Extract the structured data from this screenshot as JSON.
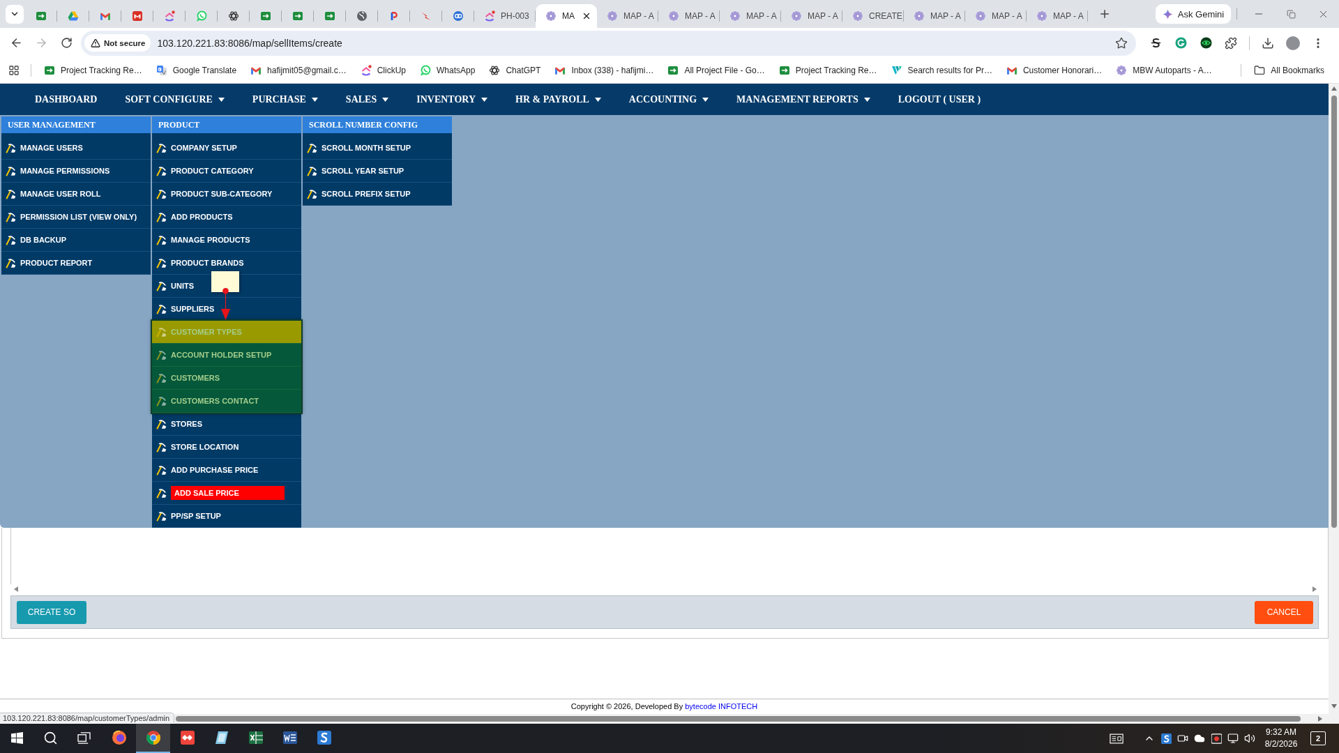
{
  "browser": {
    "tabs": [
      {
        "kind": "icon",
        "selected": false
      },
      {
        "kind": "icon",
        "selected": false
      },
      {
        "kind": "icon",
        "selected": false
      },
      {
        "kind": "icon",
        "selected": false
      },
      {
        "kind": "icon",
        "selected": false
      },
      {
        "kind": "icon",
        "selected": false
      },
      {
        "kind": "icon",
        "selected": false
      },
      {
        "kind": "icon",
        "selected": false
      },
      {
        "kind": "icon",
        "selected": false
      },
      {
        "kind": "icon",
        "selected": false
      },
      {
        "kind": "icon",
        "selected": false
      },
      {
        "kind": "icon",
        "selected": false
      },
      {
        "kind": "icon",
        "selected": false
      },
      {
        "kind": "icon",
        "selected": false
      },
      {
        "kind": "titled",
        "title": "PH-003",
        "selected": false
      },
      {
        "kind": "titled",
        "title": "MA",
        "selected": true
      },
      {
        "kind": "titled",
        "title": "MAP - A",
        "selected": false
      },
      {
        "kind": "titled",
        "title": "MAP - A",
        "selected": false
      },
      {
        "kind": "titled",
        "title": "MAP - A",
        "selected": false
      },
      {
        "kind": "titled",
        "title": "MAP - A",
        "selected": false
      },
      {
        "kind": "titled",
        "title": "CREATE",
        "selected": false
      },
      {
        "kind": "titled",
        "title": "MAP - A",
        "selected": false
      },
      {
        "kind": "titled",
        "title": "MAP - A",
        "selected": false
      },
      {
        "kind": "titled",
        "title": "MAP - A",
        "selected": false
      }
    ],
    "ask_button": "Ask Gemini",
    "security_label": "Not secure",
    "url": "103.120.221.83:8086/map/sellItems/create",
    "bookmarks": [
      {
        "title": "Project Tracking Re…"
      },
      {
        "title": "Google Translate"
      },
      {
        "title": "hafijmit05@gmail.c…"
      },
      {
        "title": "ClickUp"
      },
      {
        "title": "WhatsApp"
      },
      {
        "title": "ChatGPT"
      },
      {
        "title": "Inbox (338) - hafijmi…"
      },
      {
        "title": "All Project File - Go…"
      },
      {
        "title": "Project Tracking Re…"
      },
      {
        "title": "Search results for Pr…"
      },
      {
        "title": "Customer Honorari…"
      },
      {
        "title": "MBW Autoparts - A…"
      }
    ],
    "all_bookmarks": "All Bookmarks",
    "status_url": "103.120.221.83:8086/map/customerTypes/admin"
  },
  "nav": [
    {
      "label": "DASHBOARD",
      "dropdown": false
    },
    {
      "label": "SOFT CONFIGURE",
      "dropdown": true
    },
    {
      "label": "PURCHASE",
      "dropdown": true
    },
    {
      "label": "SALES",
      "dropdown": true
    },
    {
      "label": "INVENTORY",
      "dropdown": true
    },
    {
      "label": "HR & PAYROLL",
      "dropdown": true
    },
    {
      "label": "ACCOUNTING",
      "dropdown": true
    },
    {
      "label": "MANAGEMENT REPORTS",
      "dropdown": true
    },
    {
      "label": "LOGOUT ( USER )",
      "dropdown": false
    }
  ],
  "menu": [
    {
      "heading": "USER MANAGEMENT",
      "items": [
        {
          "kind": "link",
          "label": "MANAGE USERS"
        },
        {
          "kind": "link",
          "label": "MANAGE PERMISSIONS"
        },
        {
          "kind": "link",
          "label": "MANAGE USER ROLL"
        },
        {
          "kind": "link",
          "label": "PERMISSION LIST (VIEW ONLY)"
        },
        {
          "kind": "link",
          "label": "DB BACKUP"
        },
        {
          "kind": "link",
          "label": "PRODUCT REPORT"
        }
      ]
    },
    {
      "heading": "PRODUCT",
      "items": [
        {
          "kind": "link",
          "label": "COMPANY SETUP",
          "flagged": false
        },
        {
          "kind": "link",
          "label": "PRODUCT CATEGORY",
          "flagged": false
        },
        {
          "kind": "link",
          "label": "PRODUCT SUB-CATEGORY",
          "flagged": false
        },
        {
          "kind": "link",
          "label": "ADD PRODUCTS",
          "flagged": false
        },
        {
          "kind": "link",
          "label": "MANAGE PRODUCTS",
          "flagged": false
        },
        {
          "kind": "link",
          "label": "PRODUCT BRANDS",
          "flagged": false
        },
        {
          "kind": "link",
          "label": "UNITS",
          "flagged": false
        },
        {
          "kind": "link",
          "label": "SUPPLIERS",
          "flagged": false
        },
        {
          "kind": "group",
          "items": [
            {
              "label": "CUSTOMER TYPES",
              "hovered": true
            },
            {
              "label": "ACCOUNT HOLDER SETUP",
              "hovered": false
            },
            {
              "label": "CUSTOMERS",
              "hovered": false
            },
            {
              "label": "CUSTOMERS CONTACT",
              "hovered": false
            }
          ]
        },
        {
          "kind": "link",
          "label": "STORES",
          "flagged": false
        },
        {
          "kind": "link",
          "label": "STORE LOCATION",
          "flagged": false
        },
        {
          "kind": "link",
          "label": "ADD PURCHASE PRICE",
          "flagged": false
        },
        {
          "kind": "link",
          "label": "ADD SALE PRICE",
          "flagged": true
        },
        {
          "kind": "link",
          "label": "PP/SP SETUP",
          "flagged": false
        }
      ]
    },
    {
      "heading": "SCROLL NUMBER CONFIG",
      "items": [
        {
          "kind": "link",
          "label": "SCROLL MONTH SETUP"
        },
        {
          "kind": "link",
          "label": "SCROLL YEAR SETUP"
        },
        {
          "kind": "link",
          "label": "SCROLL PREFIX SETUP"
        }
      ]
    }
  ],
  "form": {
    "create_button": "CREATE SO",
    "cancel_button": "CANCEL"
  },
  "footer": {
    "text": "Copyright © 2026, Developed By",
    "link": "bytecode INFOTECH"
  },
  "taskbar": {
    "apps": [
      {
        "active": false
      },
      {
        "active": true
      },
      {
        "active": false
      },
      {
        "active": false
      },
      {
        "active": false
      },
      {
        "active": false
      },
      {
        "active": false
      }
    ],
    "time": "9:32 AM",
    "date": "8/2/2026",
    "notification_count": "2"
  }
}
